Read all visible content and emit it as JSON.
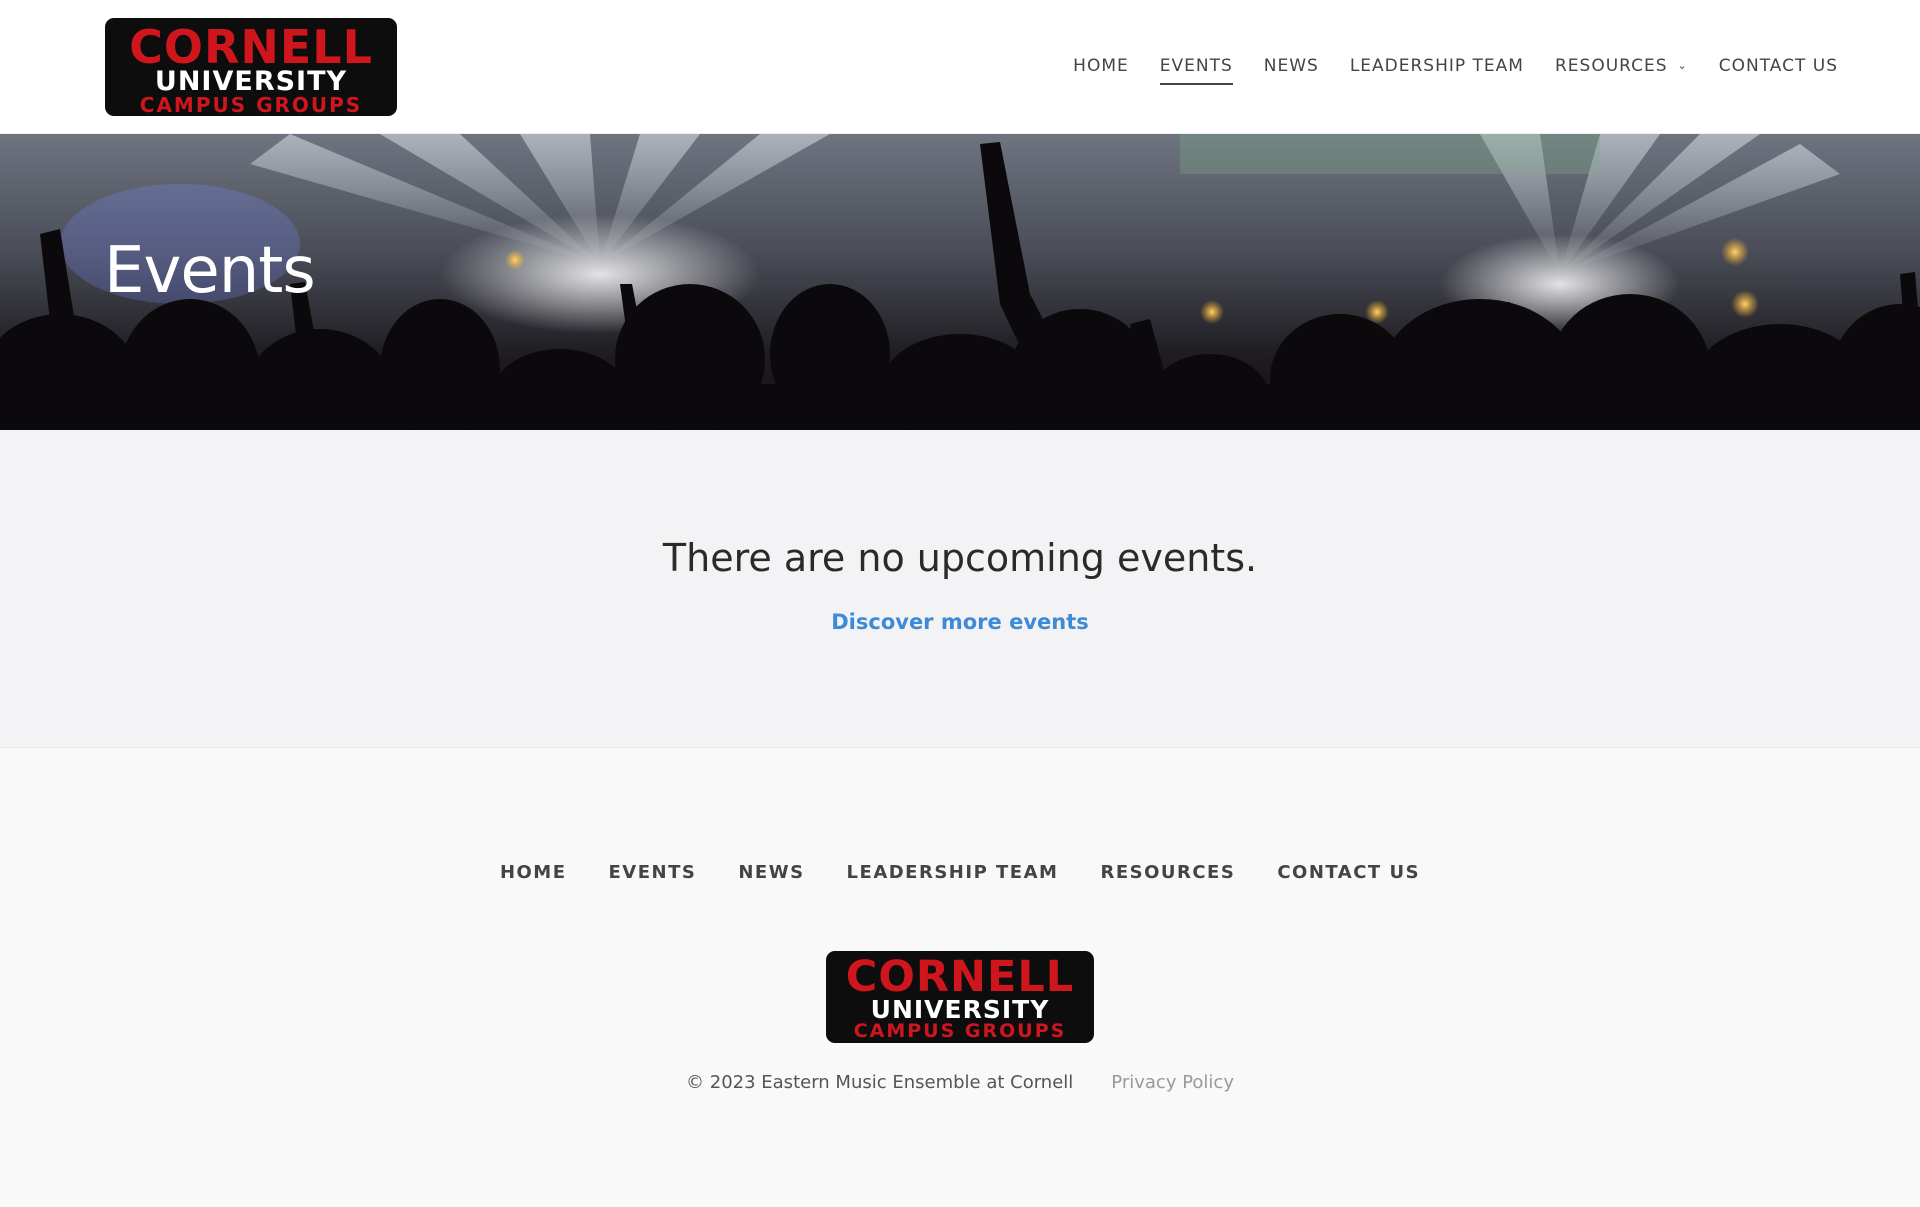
{
  "header": {
    "logo": {
      "line1": "CORNELL",
      "line2": "UNIVERSITY",
      "line3": "CAMPUS GROUPS"
    },
    "nav": [
      {
        "label": "HOME"
      },
      {
        "label": "EVENTS"
      },
      {
        "label": "NEWS"
      },
      {
        "label": "LEADERSHIP TEAM"
      },
      {
        "label": "RESOURCES"
      },
      {
        "label": "CONTACT US"
      }
    ],
    "active_item": "EVENTS",
    "resources_icon": "chevron-down-icon"
  },
  "hero": {
    "title": "Events",
    "background": "concert-crowd-photo"
  },
  "main": {
    "empty_message": "There are no upcoming events.",
    "discover_link": "Discover more events",
    "link_color": "#3d8ad6"
  },
  "footer": {
    "nav": [
      {
        "label": "HOME"
      },
      {
        "label": "EVENTS"
      },
      {
        "label": "NEWS"
      },
      {
        "label": "LEADERSHIP TEAM"
      },
      {
        "label": "RESOURCES"
      },
      {
        "label": "CONTACT US"
      }
    ],
    "logo": {
      "line1": "CORNELL",
      "line2": "UNIVERSITY",
      "line3": "CAMPUS GROUPS"
    },
    "copyright": "© 2023 Eastern Music Ensemble at Cornell",
    "privacy": "Privacy Policy"
  },
  "colors": {
    "logo_red": "#d0161d",
    "logo_bg": "#0d0d0d"
  }
}
